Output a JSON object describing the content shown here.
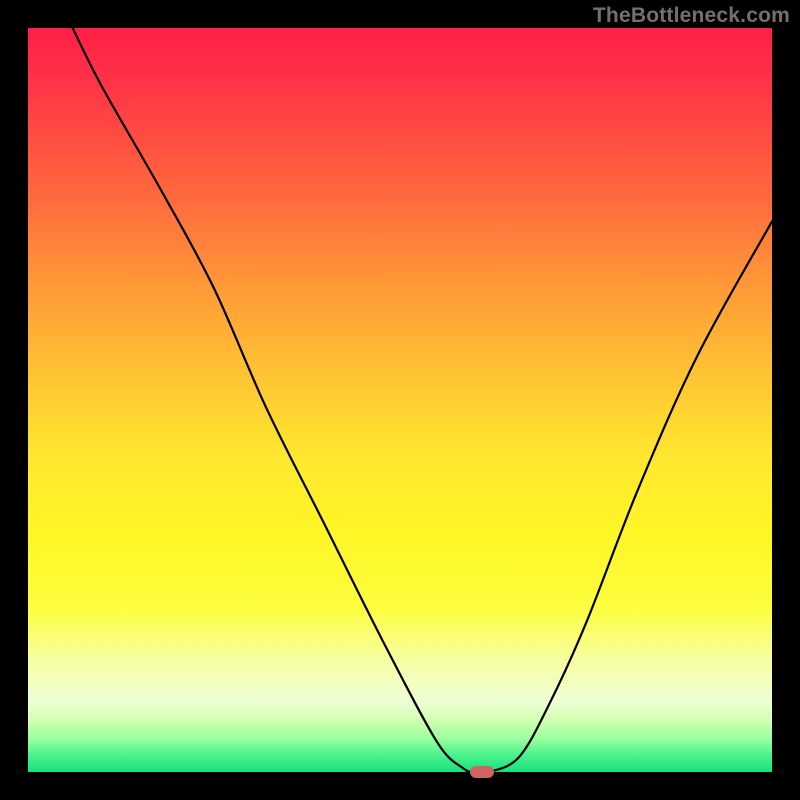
{
  "watermark": "TheBottleneck.com",
  "chart_data": {
    "type": "line",
    "title": "",
    "xlabel": "",
    "ylabel": "",
    "xlim": [
      0,
      100
    ],
    "ylim": [
      0,
      100
    ],
    "background_gradient_stops": [
      {
        "pos": 0.0,
        "color": "#ff1f46"
      },
      {
        "pos": 0.06,
        "color": "#ff2f47"
      },
      {
        "pos": 0.14,
        "color": "#ff4a42"
      },
      {
        "pos": 0.24,
        "color": "#ff6e3d"
      },
      {
        "pos": 0.34,
        "color": "#ff9638"
      },
      {
        "pos": 0.46,
        "color": "#ffc233"
      },
      {
        "pos": 0.58,
        "color": "#ffe82f"
      },
      {
        "pos": 0.68,
        "color": "#fff626"
      },
      {
        "pos": 0.78,
        "color": "#fdfe3f"
      },
      {
        "pos": 0.85,
        "color": "#f7ffa2"
      },
      {
        "pos": 0.905,
        "color": "#eeffd6"
      },
      {
        "pos": 0.93,
        "color": "#d2ffb3"
      },
      {
        "pos": 0.955,
        "color": "#9cffa0"
      },
      {
        "pos": 0.975,
        "color": "#50f58e"
      },
      {
        "pos": 1.0,
        "color": "#17e07c"
      }
    ],
    "series": [
      {
        "name": "bottleneck-curve",
        "x": [
          6.0,
          10.0,
          18.0,
          25.0,
          32.0,
          40.0,
          48.0,
          55.0,
          58.5,
          60.0,
          62.0,
          66.0,
          70.0,
          75.0,
          82.0,
          90.0,
          100.0
        ],
        "y": [
          100.0,
          92.0,
          78.0,
          65.0,
          49.0,
          33.0,
          17.0,
          4.0,
          0.5,
          0.0,
          0.0,
          2.0,
          9.0,
          20.0,
          38.0,
          56.0,
          74.0
        ]
      }
    ],
    "marker": {
      "x": 61.0,
      "y": 0.0,
      "color": "#cf6364"
    }
  }
}
